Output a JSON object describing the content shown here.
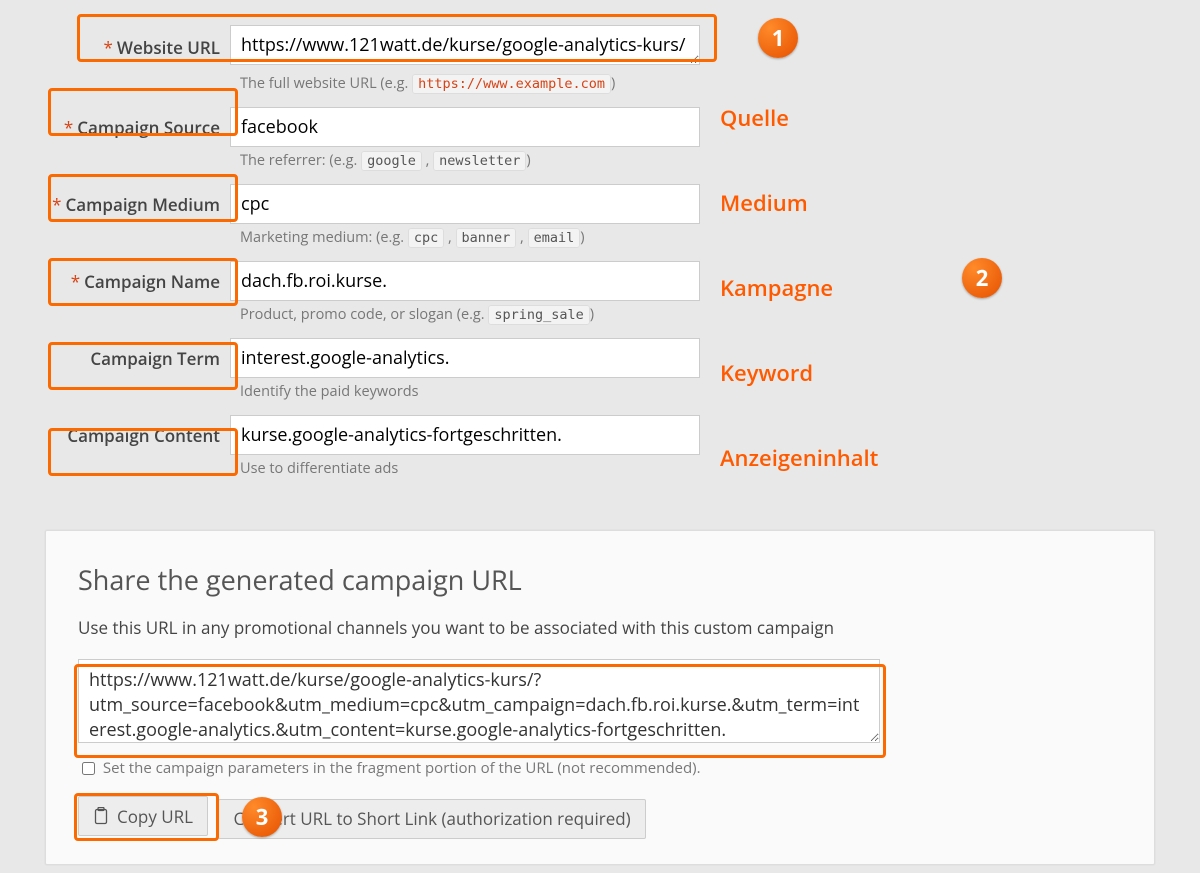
{
  "fields": [
    {
      "label": "Website URL",
      "required": true,
      "value": "https://www.121watt.de/kurse/google-analytics-kurs/",
      "hint_prefix": "The full website URL (e.g. ",
      "hint_code": "https://www.example.com",
      "hint_suffix": ")",
      "anno": ""
    },
    {
      "label": "Campaign Source",
      "required": true,
      "value": "facebook",
      "hint_prefix": "The referrer: (e.g. ",
      "hint_code": "google",
      "hint_code2": "newsletter",
      "hint_suffix": ")",
      "anno": "Quelle"
    },
    {
      "label": "Campaign Medium",
      "required": true,
      "value": "cpc",
      "hint_prefix": "Marketing medium: (e.g. ",
      "hint_code": "cpc",
      "hint_code2": "banner",
      "hint_code3": "email",
      "hint_suffix": ")",
      "anno": "Medium"
    },
    {
      "label": "Campaign Name",
      "required": true,
      "value": "dach.fb.roi.kurse.",
      "hint_prefix": "Product, promo code, or slogan (e.g. ",
      "hint_code": "spring_sale",
      "hint_suffix": ")",
      "anno": "Kampagne"
    },
    {
      "label": "Campaign Term",
      "required": false,
      "value": "interest.google-analytics.",
      "hint_prefix": "Identify the paid keywords",
      "anno": "Keyword"
    },
    {
      "label": "Campaign Content",
      "required": false,
      "value": "kurse.google-analytics-fortgeschritten.",
      "hint_prefix": "Use to differentiate ads",
      "anno": "Anzeigeninhalt"
    }
  ],
  "share": {
    "title": "Share the generated campaign URL",
    "desc": "Use this URL in any promotional channels you want to be associated with this custom campaign",
    "url": "https://www.121watt.de/kurse/google-analytics-kurs/?utm_source=facebook&utm_medium=cpc&utm_campaign=dach.fb.roi.kurse.&utm_term=interest.google-analytics.&utm_content=kurse.google-analytics-fortgeschritten.",
    "fragment_label": "Set the campaign parameters in the fragment portion of the URL (not recommended).",
    "copy_label": "Copy URL",
    "convert_label": "Convert URL to Short Link (authorization required)"
  },
  "badges": {
    "1": "1",
    "2": "2",
    "3": "3"
  }
}
